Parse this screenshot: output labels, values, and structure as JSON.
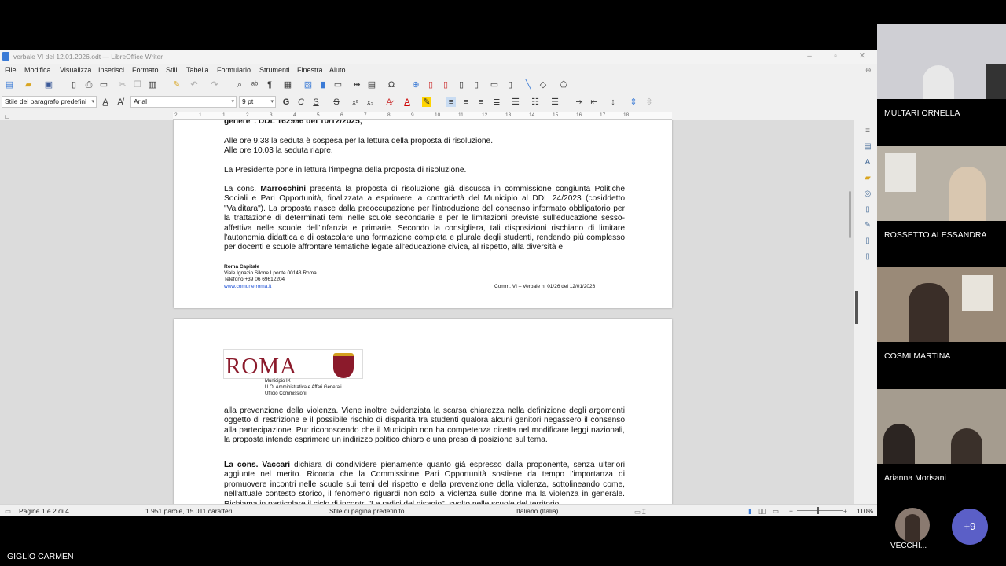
{
  "window": {
    "title": "verbale VI del 12.01.2026.odt — LibreOffice Writer"
  },
  "menu": [
    "File",
    "Modifica",
    "Visualizza",
    "Inserisci",
    "Formato",
    "Stili",
    "Tabella",
    "Formulario",
    "Strumenti",
    "Finestra",
    "Aiuto"
  ],
  "format_bar": {
    "paragraph_style": "Stile del paragrafo predefini",
    "font": "Arial",
    "size": "9 pt",
    "bold": "G",
    "italic": "C",
    "underline": "S",
    "strike": "S",
    "superscript": "x²",
    "subscript": "x₂"
  },
  "ruler": [
    "2",
    "1",
    "1",
    "2",
    "3",
    "4",
    "5",
    "6",
    "7",
    "8",
    "9",
    "10",
    "11",
    "12",
    "13",
    "14",
    "15",
    "16",
    "17",
    "18"
  ],
  "page1": {
    "heading_tail": "genere\". DDL 162996 del 10/12/2025,",
    "p1a": "Alle ore 9.38 la seduta è sospesa per la lettura della proposta di risoluzione.",
    "p1b": "Alle ore 10.03 la seduta riapre.",
    "p2": "La Presidente pone in lettura l'impegna della proposta di risoluzione.",
    "p3_lead": "La cons. ",
    "p3_name": "Marrocchini",
    "p3_body": " presenta la proposta di risoluzione già discussa in commissione congiunta Politiche Sociali e Pari Opportunità, finalizzata a esprimere la contrarietà del Municipio al DDL 24/2023 (cosiddetto \"Valditara\"). La proposta nasce dalla preoccupazione per l'introduzione del consenso informato obbligatorio per la trattazione di determinati temi nelle scuole secondarie e per le limitazioni previste sull'educazione sesso-affettiva nelle scuole dell'infanzia e primarie. Secondo la consigliera, tali disposizioni rischiano di limitare l'autonomia didattica e di ostacolare una formazione completa e plurale degli studenti, rendendo più complesso per docenti e scuole affrontare tematiche legate all'educazione civica, al rispetto, alla diversità e",
    "footer_org": "Roma Capitale",
    "footer_addr": "Viale Ignazio Silone I ponte  00143 Roma",
    "footer_tel": "Telefono +39 06 69612204",
    "footer_web": "www.comune.roma.it",
    "footer_ref": "Comm. VI – Verbale n. 01/26 del 12/01/2026"
  },
  "page2": {
    "logo_text": "ROMA",
    "header_l1": "Municipio IX",
    "header_l2": "U.O. Amministrativa e Affari  Generali",
    "header_l3": "Ufficio Commissioni",
    "p1": "alla prevenzione della violenza. Viene inoltre evidenziata la scarsa chiarezza nella definizione degli argomenti oggetto di restrizione e il possibile rischio di disparità tra studenti qualora alcuni genitori negassero il consenso alla partecipazione. Pur riconoscendo che il Municipio non ha competenza diretta nel modificare leggi nazionali, la proposta intende esprimere un indirizzo politico chiaro e una presa di posizione sul tema.",
    "p2_name": "La cons. Vaccari",
    "p2_body": " dichiara di condividere pienamente quanto già espresso dalla proponente, senza ulteriori aggiunte nel merito. Ricorda che la Commissione Pari Opportunità sostiene da tempo l'importanza di promuovere incontri nelle scuole sui temi del rispetto e della prevenzione della violenza, sottolineando come, nell'attuale contesto storico, il fenomeno riguardi non solo la violenza sulle donne ma la violenza in generale. Richiama in particolare il ciclo di incontri \"Le radici del disagio\", svolto nelle scuole del territorio"
  },
  "status": {
    "pages": "Pagine 1 e 2 di 4",
    "words": "1.951 parole, 15.011 caratteri",
    "page_style": "Stile di pagina predefinito",
    "language": "Italiano (Italia)",
    "zoom": "110%"
  },
  "participants": [
    {
      "name": "MULTARI ORNELLA",
      "bg": "#cfcfd4"
    },
    {
      "name": "ROSSETTO ALESSANDRA",
      "bg": "#b9b2a6"
    },
    {
      "name": "COSMI MARTINA",
      "bg": "#9a8a78"
    },
    {
      "name": "Arianna Morisani",
      "bg": "#a59c8f"
    }
  ],
  "presenter": "GIGLIO CARMEN",
  "self_tile": "VECCHI...",
  "more_count": "+9"
}
